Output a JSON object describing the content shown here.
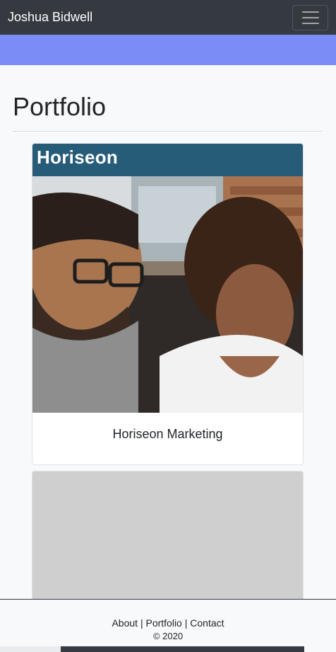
{
  "navbar": {
    "brand": "Joshua Bidwell",
    "menu_icon": "hamburger-icon"
  },
  "main": {
    "title": "Portfolio",
    "cards": [
      {
        "banner_text": "Horiseon",
        "title": "Horiseon Marketing",
        "image": "photo of two people looking at a screen"
      },
      {
        "image": "gray placeholder image"
      }
    ]
  },
  "footer": {
    "links": [
      {
        "label": "About"
      },
      {
        "label": "Portfolio"
      },
      {
        "label": "Contact"
      }
    ],
    "separator": "|",
    "copyright": "© 2020"
  },
  "colors": {
    "navbar_bg": "#343a40",
    "hero_bg": "#7b8cf7",
    "banner_bg": "#265c78",
    "page_bg": "#f8f9fa",
    "placeholder_bg": "#cfcfcf"
  }
}
